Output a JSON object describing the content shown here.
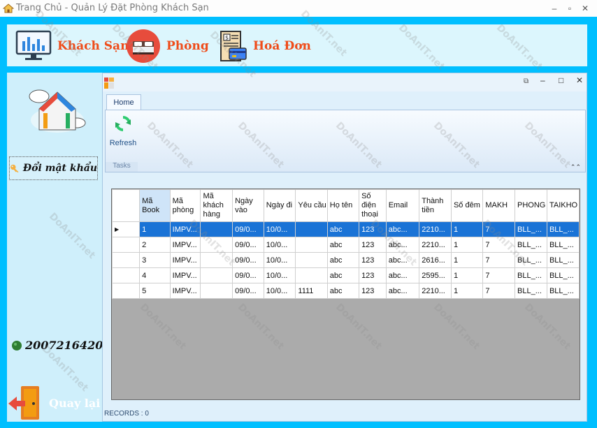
{
  "window": {
    "title": "Trang Chủ - Quản Lý Đặt Phòng Khách Sạn",
    "min_icon": "minimize-icon",
    "max_icon": "maximize-icon",
    "close_icon": "close-icon"
  },
  "nav": {
    "items": [
      {
        "label": "Khách Sạn",
        "icon": "monitor-chart-icon"
      },
      {
        "label": "Phòng",
        "icon": "bed-icon"
      },
      {
        "label": "Hoá Đơn",
        "icon": "invoice-icon"
      }
    ],
    "accent": "#ef4c1a"
  },
  "sidebar": {
    "logo_icon": "house-cloud-icon",
    "change_password_label": "Đổi mật khẩu",
    "user_id": "2007216420",
    "back_label": "Quay lại"
  },
  "child_window": {
    "ribbon_tab": "Home",
    "refresh_label": "Refresh",
    "group_label": "Tasks",
    "status": "RECORDS : 0"
  },
  "grid": {
    "columns": [
      "Mã Book",
      "Mã phòng",
      "Mã khách hàng",
      "Ngày vào",
      "Ngày đi",
      "Yêu cầu",
      "Họ tên",
      "Số điện thoại",
      "Email",
      "Thành tiền",
      "Số đêm",
      "MAKH",
      "PHONG",
      "TAIKHO"
    ],
    "rows": [
      [
        "1",
        "IMPV...",
        "",
        "09/0...",
        "10/0...",
        "",
        "abc",
        "123",
        "abc...",
        "2210...",
        "1",
        "7",
        "BLL_...",
        "BLL_..."
      ],
      [
        "2",
        "IMPV...",
        "",
        "09/0...",
        "10/0...",
        "",
        "abc",
        "123",
        "abc...",
        "2210...",
        "1",
        "7",
        "BLL_...",
        "BLL_..."
      ],
      [
        "3",
        "IMPV...",
        "",
        "09/0...",
        "10/0...",
        "",
        "abc",
        "123",
        "abc...",
        "2616...",
        "1",
        "7",
        "BLL_...",
        "BLL_..."
      ],
      [
        "4",
        "IMPV...",
        "",
        "09/0...",
        "10/0...",
        "",
        "abc",
        "123",
        "abc...",
        "2595...",
        "1",
        "7",
        "BLL_...",
        "BLL_..."
      ],
      [
        "5",
        "IMPV...",
        "",
        "09/0...",
        "10/0...",
        "1111",
        "abc",
        "123",
        "abc...",
        "2210...",
        "1",
        "7",
        "BLL_...",
        "BLL_..."
      ]
    ],
    "selected_row": 0,
    "selection_color": "#1a73d6"
  },
  "watermark": "DoAnIT.net"
}
